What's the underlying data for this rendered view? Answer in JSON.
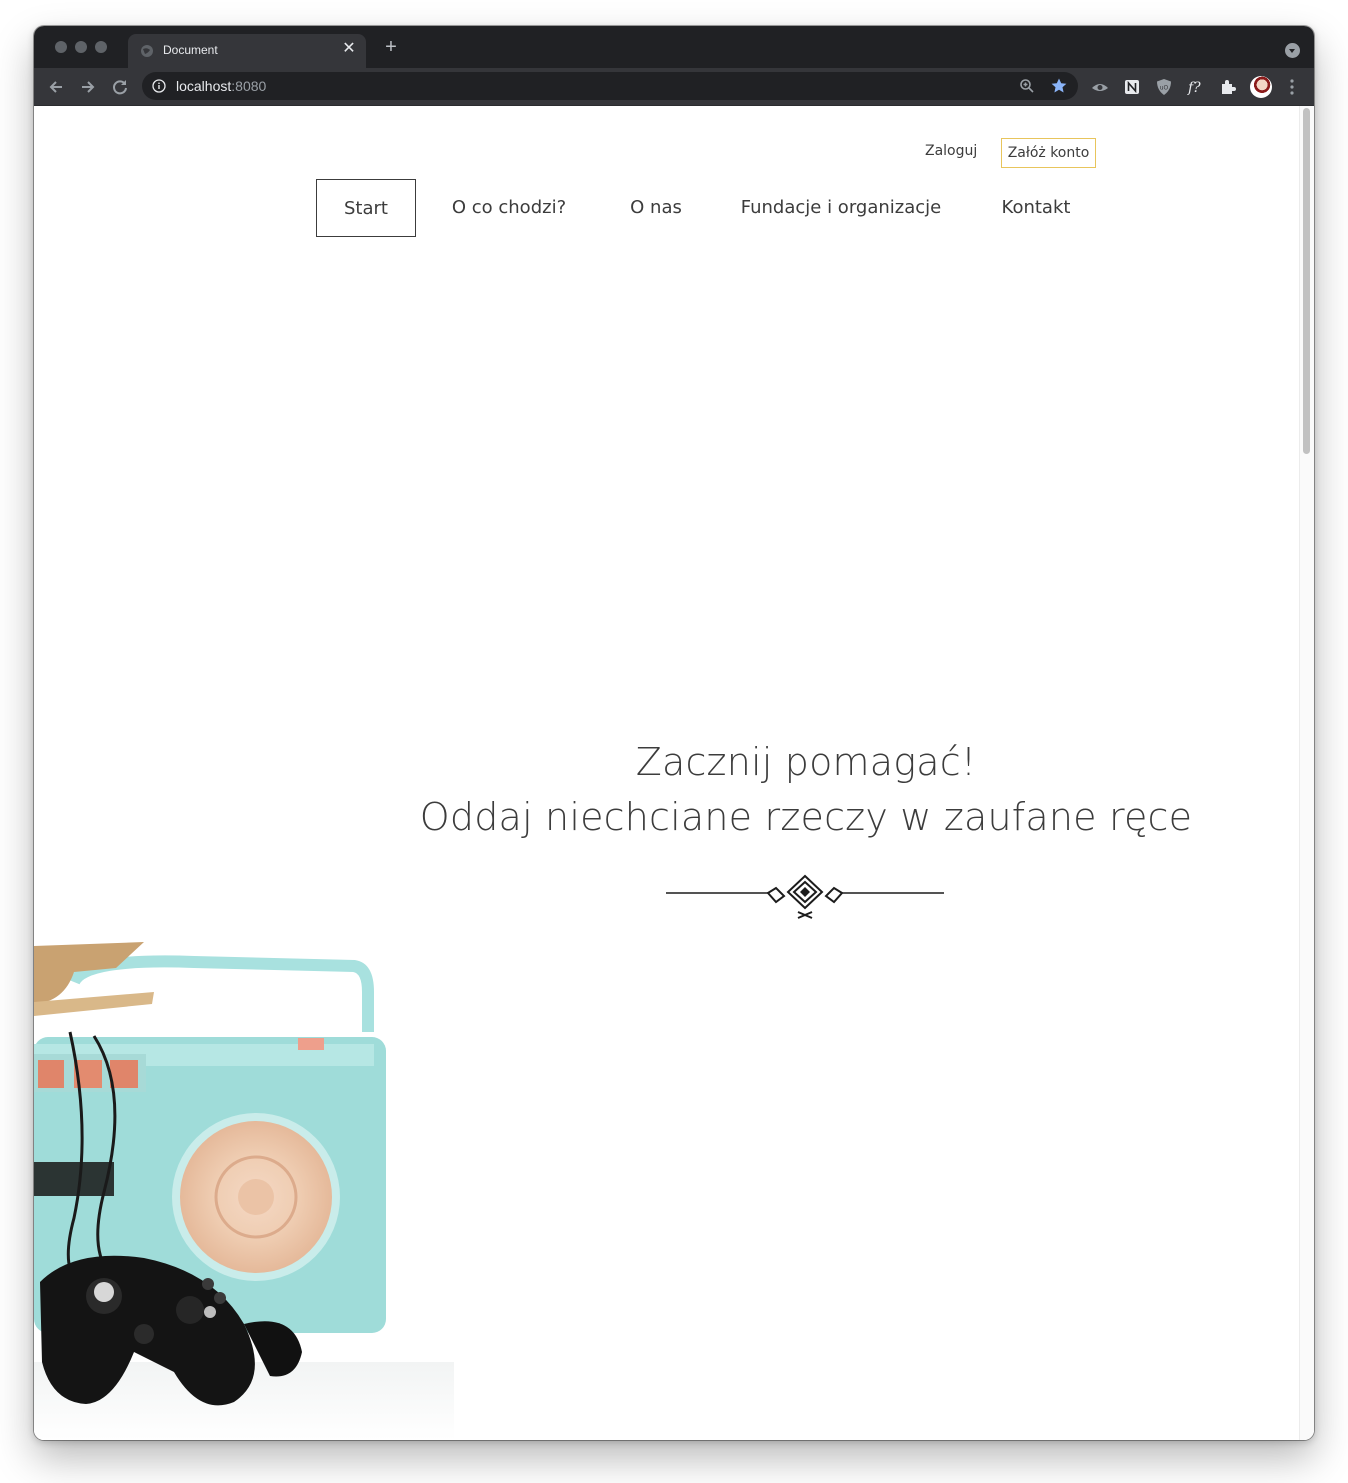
{
  "browser": {
    "tab_title": "Document",
    "url_host": "localhost",
    "url_port": ":8080"
  },
  "header": {
    "login_label": "Zaloguj",
    "register_label": "Załóż konto",
    "register_border_color": "#e8c55c"
  },
  "nav": {
    "items": [
      {
        "label": "Start",
        "active": true
      },
      {
        "label": "O co chodzi?"
      },
      {
        "label": "O nas"
      },
      {
        "label": "Fundacje i organizacje"
      },
      {
        "label": "Kontakt"
      }
    ]
  },
  "hero": {
    "line1": "Zacznij pomagać!",
    "line2": "Oddaj niechciane rzeczy w zaufane ręce",
    "decoration_icon": "ornamental-divider-icon",
    "image": "radio-and-gamepad-photo"
  }
}
